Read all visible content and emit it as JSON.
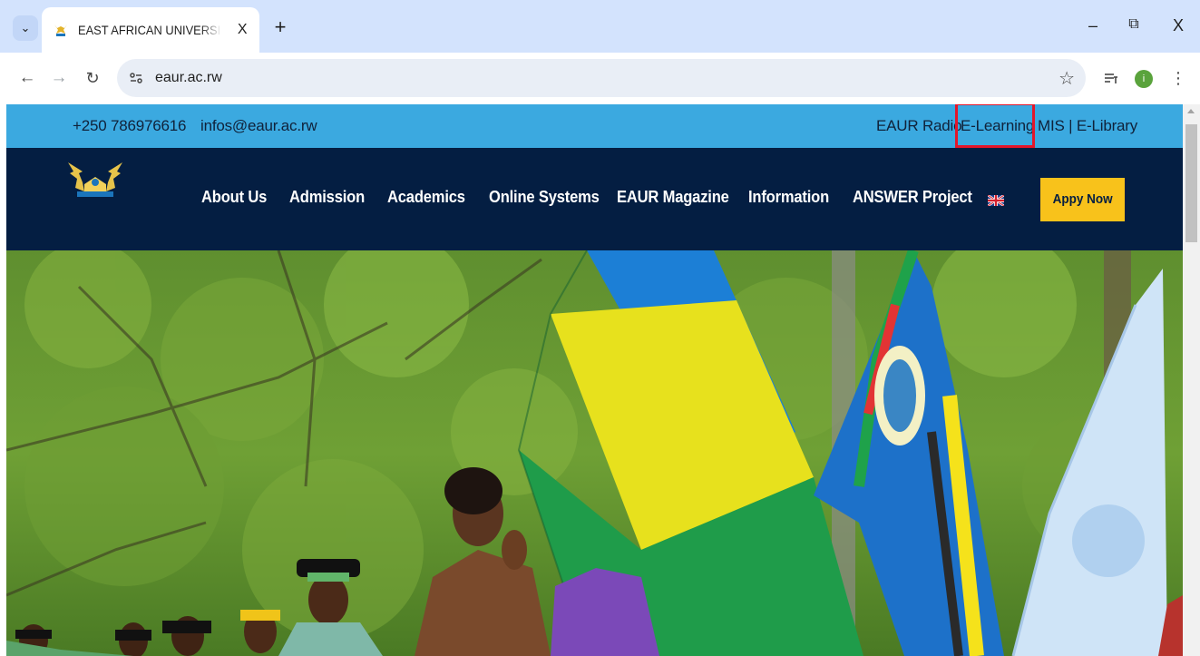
{
  "browser": {
    "tab_title": "EAST AFRICAN UNIVERSITY RW",
    "tab_close": "X",
    "new_tab": "+",
    "url": "eaur.ac.rw",
    "window_minimize": "–",
    "window_restore": "⧉",
    "window_close": "X",
    "avatar_initial": "i",
    "icons": [
      "tab-search-icon",
      "back-icon",
      "forward-icon",
      "reload-icon",
      "site-info-icon",
      "bookmark-star-icon",
      "reading-list-icon",
      "profile-avatar-icon",
      "menu-icon"
    ]
  },
  "topbar": {
    "phone": "+250 786976616",
    "email": "infos@eaur.ac.rw",
    "links": [
      "EAUR Radio",
      "E-Learning",
      "MIS | E-Library"
    ],
    "highlight_color": "#e3162a"
  },
  "navbar": {
    "items": [
      "About Us",
      "Admission",
      "Academics",
      "Online Systems",
      "EAUR Magazine",
      "Information",
      "ANSWER Project"
    ],
    "apply_label": "Appy Now",
    "language_icon": "uk-flag-icon"
  },
  "colors": {
    "topbar": "#3ba9e0",
    "navbar": "#041e42",
    "apply_button": "#f8c21b"
  }
}
